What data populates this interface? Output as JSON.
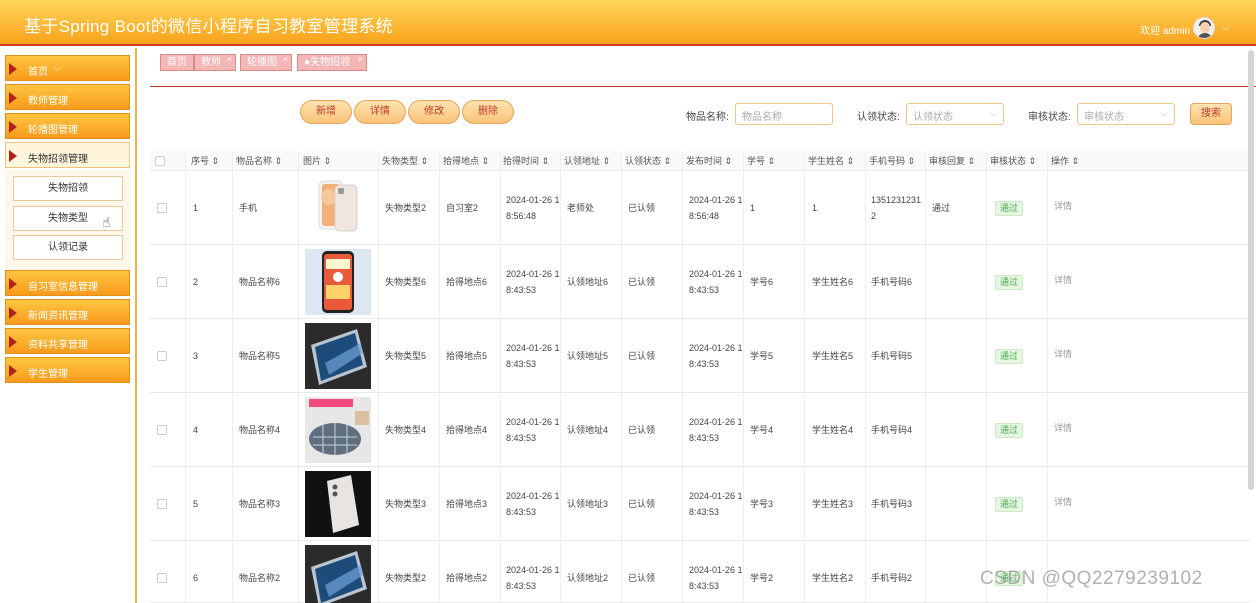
{
  "header": {
    "title": "基于Spring Boot的微信小程序自习教室管理系统",
    "welcome": "欢迎 admin",
    "chevron": "⌵"
  },
  "sidebar": {
    "items": [
      {
        "label": "首页",
        "chevron": "⌵"
      },
      {
        "label": "教师管理"
      },
      {
        "label": "轮播图管理"
      },
      {
        "label": "失物招领管理"
      },
      {
        "label": "自习室信息管理"
      },
      {
        "label": "新闻资讯管理"
      },
      {
        "label": "资料共享管理"
      },
      {
        "label": "学生管理"
      }
    ],
    "submenu": [
      "失物招领",
      "失物类型",
      "认领记录"
    ]
  },
  "tabs": [
    {
      "label": "首页"
    },
    {
      "label": "教师",
      "close": "×"
    },
    {
      "label": "轮播图",
      "close": "×"
    },
    {
      "label": "●失物招领",
      "close": "×"
    }
  ],
  "toolbar": {
    "add": "新增",
    "detail": "详情",
    "edit": "修改",
    "delete": "删除",
    "name_label": "物品名称:",
    "name_placeholder": "物品名称",
    "claim_label": "认领状态:",
    "claim_placeholder": "认领状态",
    "audit_label": "审核状态:",
    "audit_placeholder": "审核状态",
    "search": "搜索"
  },
  "table": {
    "columns": [
      "序号 ⇕",
      "物品名称 ⇕",
      "图片 ⇕",
      "失物类型 ⇕",
      "拾得地点 ⇕",
      "拾得时间 ⇕",
      "认领地址 ⇕",
      "认领状态 ⇕",
      "发布时间 ⇕",
      "学号 ⇕",
      "学生姓名 ⇕",
      "手机号码 ⇕",
      "审核回复 ⇕",
      "审核状态 ⇕",
      "操作 ⇕"
    ],
    "rows": [
      {
        "no": "1",
        "name": "手机",
        "type": "失物类型2",
        "place": "自习室2",
        "time1": "2024-01-26 1",
        "time2": "8:56:48",
        "addr": "老师处",
        "claim": "已认领",
        "pub1": "2024-01-26 1",
        "pub2": "8:56:48",
        "sid": "1",
        "sname": "1",
        "phone1": "1351231231",
        "phone2": "2",
        "reply": "通过",
        "audit": "通过",
        "op": "详情"
      },
      {
        "no": "2",
        "name": "物品名称6",
        "type": "失物类型6",
        "place": "拾得地点6",
        "time1": "2024-01-26 1",
        "time2": "8:43:53",
        "addr": "认领地址6",
        "claim": "已认领",
        "pub1": "2024-01-26 1",
        "pub2": "8:43:53",
        "sid": "学号6",
        "sname": "学生姓名6",
        "phone1": "手机号码6",
        "phone2": "",
        "reply": "",
        "audit": "通过",
        "op": "详情"
      },
      {
        "no": "3",
        "name": "物品名称5",
        "type": "失物类型5",
        "place": "拾得地点5",
        "time1": "2024-01-26 1",
        "time2": "8:43:53",
        "addr": "认领地址5",
        "claim": "已认领",
        "pub1": "2024-01-26 1",
        "pub2": "8:43:53",
        "sid": "学号5",
        "sname": "学生姓名5",
        "phone1": "手机号码5",
        "phone2": "",
        "reply": "",
        "audit": "通过",
        "op": "详情"
      },
      {
        "no": "4",
        "name": "物品名称4",
        "type": "失物类型4",
        "place": "拾得地点4",
        "time1": "2024-01-26 1",
        "time2": "8:43:53",
        "addr": "认领地址4",
        "claim": "已认领",
        "pub1": "2024-01-26 1",
        "pub2": "8:43:53",
        "sid": "学号4",
        "sname": "学生姓名4",
        "phone1": "手机号码4",
        "phone2": "",
        "reply": "",
        "audit": "通过",
        "op": "详情"
      },
      {
        "no": "5",
        "name": "物品名称3",
        "type": "失物类型3",
        "place": "拾得地点3",
        "time1": "2024-01-26 1",
        "time2": "8:43:53",
        "addr": "认领地址3",
        "claim": "已认领",
        "pub1": "2024-01-26 1",
        "pub2": "8:43:53",
        "sid": "学号3",
        "sname": "学生姓名3",
        "phone1": "手机号码3",
        "phone2": "",
        "reply": "",
        "audit": "通过",
        "op": "详情"
      },
      {
        "no": "6",
        "name": "物品名称2",
        "type": "失物类型2",
        "place": "拾得地点2",
        "time1": "2024-01-26 1",
        "time2": "8:43:53",
        "addr": "认领地址2",
        "claim": "已认领",
        "pub1": "2024-01-26 1",
        "pub2": "8:43:53",
        "sid": "学号2",
        "sname": "学生姓名2",
        "phone1": "手机号码2",
        "phone2": "",
        "reply": "",
        "audit": "通过",
        "op": "详情"
      }
    ]
  },
  "watermark": "CSDN @QQ2279239102"
}
